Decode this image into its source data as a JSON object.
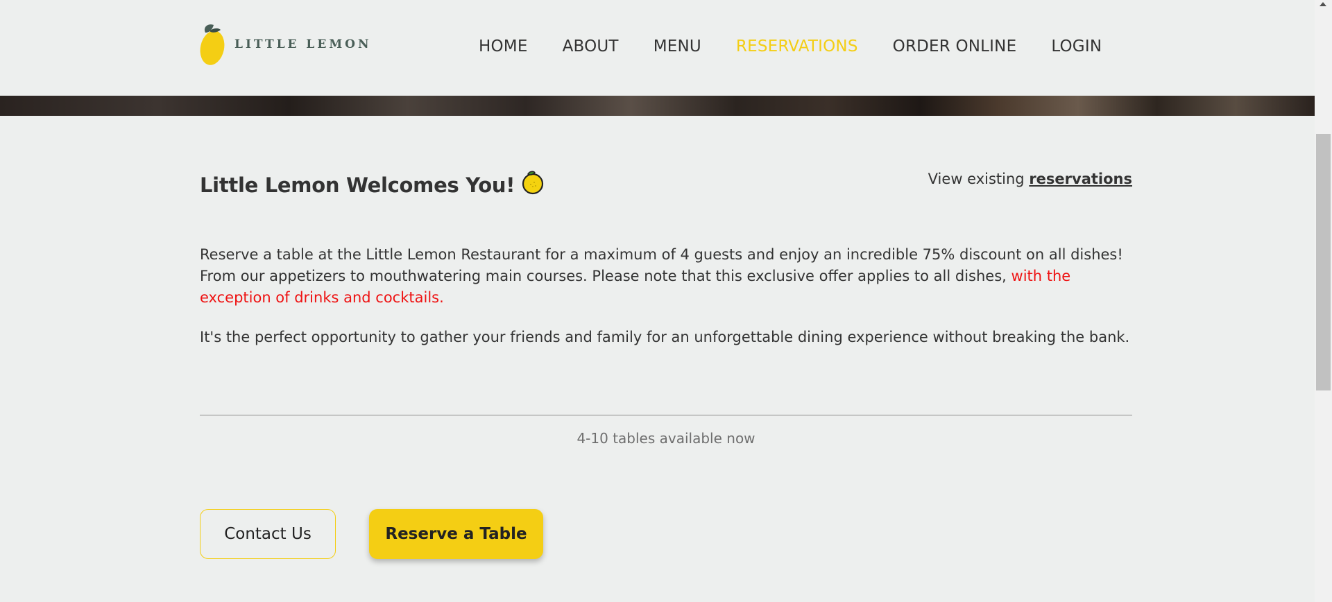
{
  "header": {
    "logo_text": "LITTLE LEMON",
    "nav": [
      {
        "label": "HOME",
        "active": false
      },
      {
        "label": "ABOUT",
        "active": false
      },
      {
        "label": "MENU",
        "active": false
      },
      {
        "label": "RESERVATIONS",
        "active": true
      },
      {
        "label": "ORDER ONLINE",
        "active": false
      },
      {
        "label": "LOGIN",
        "active": false
      }
    ]
  },
  "welcome": {
    "title": "Little Lemon Welcomes You!",
    "emoji_icon": "lemon-icon",
    "view_prefix": "View existing",
    "view_link": "reservations"
  },
  "description": {
    "line1": "Reserve a table at the Little Lemon Restaurant for a maximum of 4 guests and enjoy an incredible 75% discount on all dishes! From our appetizers to mouthwatering main courses. Please note that this exclusive offer applies to all dishes, ",
    "highlight": "with the exception of drinks and cocktails.",
    "paragraph2": "It's the perfect opportunity to gather your friends and family for an unforgettable dining experience without breaking the bank."
  },
  "availability": "4-10 tables available now",
  "buttons": {
    "contact": "Contact Us",
    "reserve": "Reserve a Table"
  },
  "colors": {
    "accent": "#f4ce14",
    "warning": "#ee1111",
    "background": "#edefee",
    "text": "#333333"
  }
}
